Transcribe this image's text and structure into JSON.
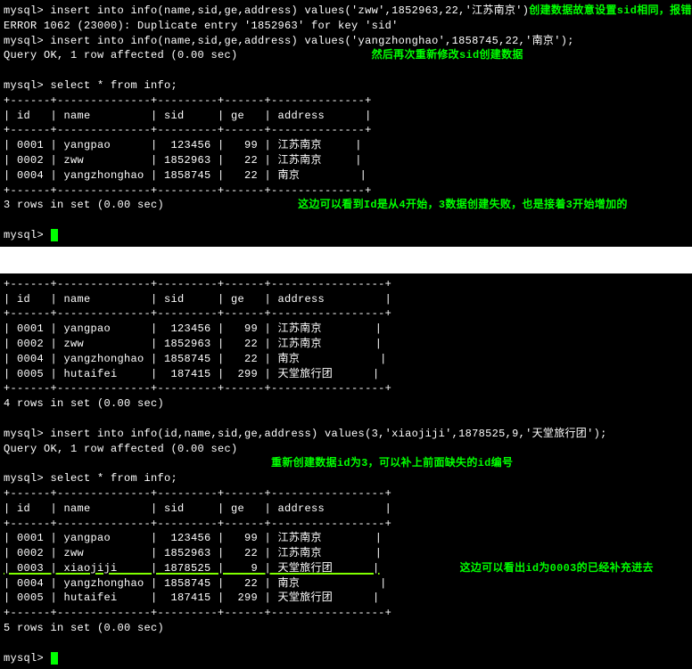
{
  "terminal1": {
    "line1_cmd": "mysql> insert into info(name,sid,ge,address) values('zww',1852963,22,'江苏南京')",
    "line1_note": "创建数据故意设置sid相同，报错",
    "line2": "ERROR 1062 (23000): Duplicate entry '1852963' for key 'sid'",
    "line3": "mysql> insert into info(name,sid,ge,address) values('yangzhonghao',1858745,22,'南京');",
    "line4": "Query OK, 1 row affected (0.00 sec)",
    "line4_note": "然后再次重新修改sid创建数据",
    "blank1": "",
    "line5": "mysql> select * from info;",
    "sep": "+------+--------------+---------+------+--------------+",
    "header": "| id   | name         | sid     | ge   | address      |",
    "row1": "| 0001 | yangpao      |  123456 |   99 | 江苏南京     |",
    "row2": "| 0002 | zww          | 1852963 |   22 | 江苏南京     |",
    "row3": "| 0004 | yangzhonghao | 1858745 |   22 | 南京         |",
    "rows_msg": "3 rows in set (0.00 sec)",
    "rows_note": "这边可以看到Id是从4开始，3数据创建失败，也是接着3开始增加的",
    "prompt": "mysql> "
  },
  "terminal2": {
    "sep": "+------+--------------+---------+------+-----------------+",
    "header": "| id   | name         | sid     | ge   | address         |",
    "row1": "| 0001 | yangpao      |  123456 |   99 | 江苏南京        |",
    "row2": "| 0002 | zww          | 1852963 |   22 | 江苏南京        |",
    "row3": "| 0004 | yangzhonghao | 1858745 |   22 | 南京            |",
    "row4": "| 0005 | hutaifei     |  187415 |  299 | 天堂旅行团      |",
    "rows_msg": "4 rows in set (0.00 sec)",
    "blank": "",
    "insert_cmd": "mysql> insert into info(id,name,sid,ge,address) values(3,'xiaojiji',1878525,9,'天堂旅行团');",
    "query_ok": "Query OK, 1 row affected (0.00 sec)",
    "insert_note": "重新创建数据id为3，可以补上前面缺失的id编号",
    "select_cmd": "mysql> select * from info;",
    "sep2": "+------+--------------+---------+------+-----------------+",
    "header2": "| id   | name         | sid     | ge   | address         |",
    "r1": "| 0001 | yangpao      |  123456 |   99 | 江苏南京        |",
    "r2": "| 0002 | zww          | 1852963 |   22 | 江苏南京        |",
    "r3": "| 0003 | xiaojiji     | 1878525 |    9 | 天堂旅行团      |",
    "r3_note": "这边可以看出id为0003的已经补充进去",
    "r4": "| 0004 | yangzhonghao | 1858745 |   22 | 南京            |",
    "r5": "| 0005 | hutaifei     |  187415 |  299 | 天堂旅行团      |",
    "rows_msg2": "5 rows in set (0.00 sec)",
    "prompt": "mysql> "
  }
}
